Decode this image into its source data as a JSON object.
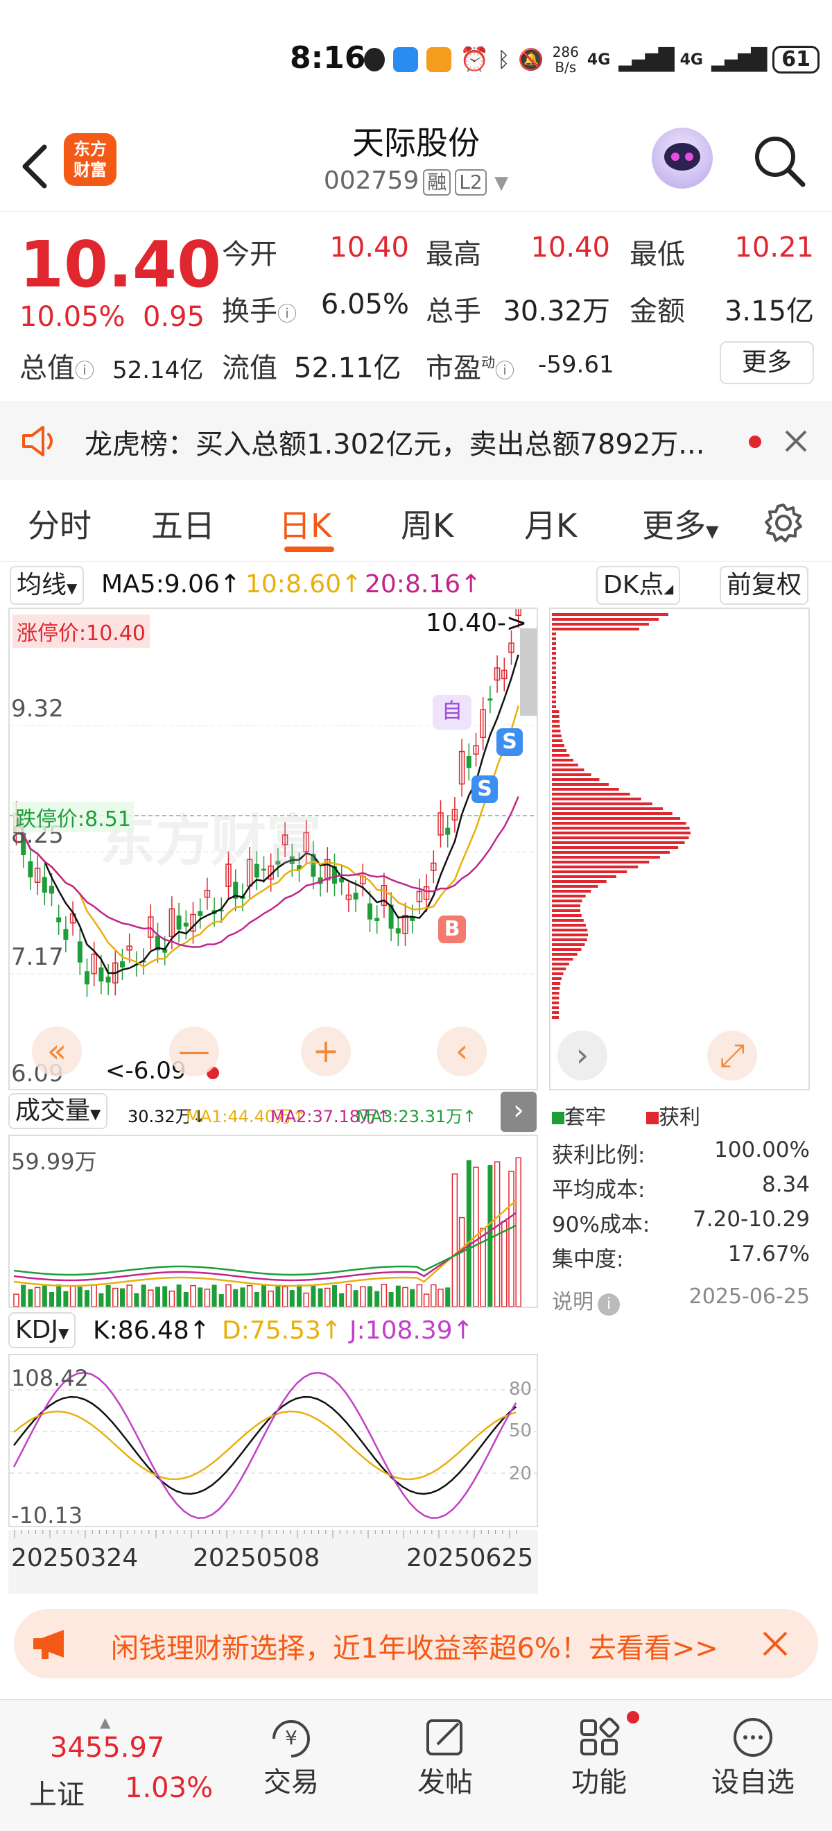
{
  "status": {
    "time": "8:16",
    "net_speed_top": "286",
    "net_speed_bottom": "B/s",
    "sig1": "4G",
    "sig2": "4G",
    "battery": "61"
  },
  "header": {
    "logo_line1": "东方",
    "logo_line2": "财富",
    "name": "天际股份",
    "code": "002759",
    "badge1": "融",
    "badge2": "L2"
  },
  "quote": {
    "price": "10.40",
    "pct": "10.05%",
    "chg": "0.95",
    "open_label": "今开",
    "open": "10.40",
    "high_label": "最高",
    "high": "10.40",
    "low_label": "最低",
    "low": "10.21",
    "turnover_label": "换手",
    "turnover": "6.05%",
    "vol_label": "总手",
    "vol": "30.32万",
    "amount_label": "金额",
    "amount": "3.15亿",
    "mcap_label": "总值",
    "mcap": "52.14亿",
    "float_label": "流值",
    "float": "52.11亿",
    "pe_label": "市盈",
    "pe_sup": "动",
    "pe": "-59.61",
    "more": "更多"
  },
  "notice": {
    "text": "龙虎榜：买入总额1.302亿元，卖出总额7892万..."
  },
  "tabs": [
    "分时",
    "五日",
    "日K",
    "周K",
    "月K",
    "更多"
  ],
  "ma": {
    "selector": "均线",
    "ma5": "MA5:9.06↑",
    "ma10": "10:8.60↑",
    "ma20": "20:8.16↑",
    "dk": "DK点",
    "adjust": "前复权"
  },
  "kchart": {
    "limit_up": "涨停价:10.40",
    "limit_down": "跌停价:8.51",
    "price_marker": "10.40->",
    "low_marker": "<-6.09",
    "y_labels": [
      "9.32",
      "8.25",
      "7.17",
      "6.09"
    ],
    "tag_self": "自",
    "tag_s": "S",
    "tag_b": "B",
    "watermark": "东方财富",
    "btn_left2": "«",
    "btn_minus": "—",
    "btn_plus": "+",
    "btn_left": "‹",
    "btn_right": "›",
    "btn_expand": "⤢"
  },
  "volume": {
    "selector": "成交量",
    "v": "30.32万↓",
    "ma1": "MA1:44.40万↑",
    "ma2": "MA2:37.18万↑",
    "ma3": "MA3:23.31万↑",
    "max": "59.99万"
  },
  "kdj": {
    "selector": "KDJ",
    "k": "K:86.48↑",
    "d": "D:75.53↑",
    "j": "J:108.39↑",
    "max": "108.42",
    "min": "-10.13",
    "lv80": "80",
    "lv50": "50",
    "lv20": "20"
  },
  "dates": [
    "20250324",
    "20250508",
    "20250625"
  ],
  "chip": {
    "legend_trapped": "套牢",
    "legend_profit": "获利",
    "rows": [
      {
        "label": "获利比例:",
        "value": "100.00%"
      },
      {
        "label": "平均成本:",
        "value": "8.34"
      },
      {
        "label": "90%成本:",
        "value": "7.20-10.29"
      },
      {
        "label": "集中度:",
        "value": "17.67%"
      }
    ],
    "note_label": "说明",
    "date": "2025-06-25"
  },
  "ad": {
    "text": "闲钱理财新选择，近1年收益率超6%！去看看>>"
  },
  "bottom_nav": {
    "index_value": "3455.97",
    "index_name": "上证",
    "index_pct": "1.03%",
    "trade": "交易",
    "post": "发帖",
    "features": "功能",
    "watch": "设自选"
  },
  "colors": {
    "accent": "#f45a16",
    "up": "#e0262f",
    "down": "#1e9e38",
    "ma5": "#111111",
    "ma10": "#e8b00c",
    "ma20": "#c0268a"
  }
}
